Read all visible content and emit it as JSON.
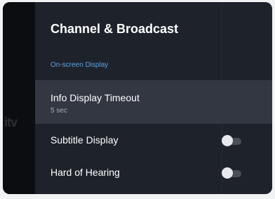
{
  "panel": {
    "title": "Channel & Broadcast",
    "section_header": "On-screen Display"
  },
  "settings": [
    {
      "label": "Info Display Timeout",
      "value": "5 sec",
      "focused": true
    },
    {
      "label": "Subtitle Display",
      "toggle": "off"
    },
    {
      "label": "Hard of Hearing",
      "toggle": "off"
    }
  ],
  "background_logo_icon": "itv-logo-icon",
  "colors": {
    "section_header": "#5fa2de",
    "focused_row": "#323741",
    "panel_bg": "#1e222b"
  }
}
